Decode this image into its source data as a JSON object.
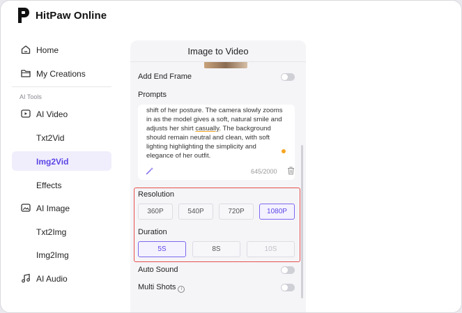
{
  "app": {
    "name": "HitPaw Online"
  },
  "sidebar": {
    "items": [
      {
        "label": "Home",
        "icon": "home-icon"
      },
      {
        "label": "My Creations",
        "icon": "folder-icon"
      }
    ],
    "section_label": "AI Tools",
    "tools": [
      {
        "label": "AI Video",
        "icon": "video-icon"
      },
      {
        "label": "Txt2Vid"
      },
      {
        "label": "Img2Vid",
        "active": true
      },
      {
        "label": "Effects"
      },
      {
        "label": "AI Image",
        "icon": "image-icon"
      },
      {
        "label": "Txt2Img"
      },
      {
        "label": "Img2Img"
      },
      {
        "label": "AI Audio",
        "icon": "music-icon"
      }
    ]
  },
  "panel": {
    "title": "Image to Video",
    "add_end_frame": {
      "label": "Add End Frame",
      "on": false
    },
    "prompts": {
      "label": "Prompts",
      "lines": [
        "shift of her posture. The camera slowly zooms",
        "in as the model gives a soft, natural smile and",
        "adjusts her shirt ",
        "casually",
        ". The background",
        "should remain neutral and clean, with soft",
        "lighting highlighting the simplicity and",
        "elegance of her outfit."
      ],
      "counter": "645/2000"
    },
    "resolution": {
      "label": "Resolution",
      "options": [
        "360P",
        "540P",
        "720P",
        "1080P"
      ],
      "selected": "1080P"
    },
    "duration": {
      "label": "Duration",
      "options": [
        "5S",
        "8S",
        "10S"
      ],
      "selected": "5S",
      "disabled": [
        "10S"
      ]
    },
    "auto_sound": {
      "label": "Auto Sound",
      "on": false
    },
    "multi_shots": {
      "label": "Multi Shots",
      "on": false
    }
  },
  "colors": {
    "accent": "#5c45e6",
    "highlight": "#e8504f"
  }
}
